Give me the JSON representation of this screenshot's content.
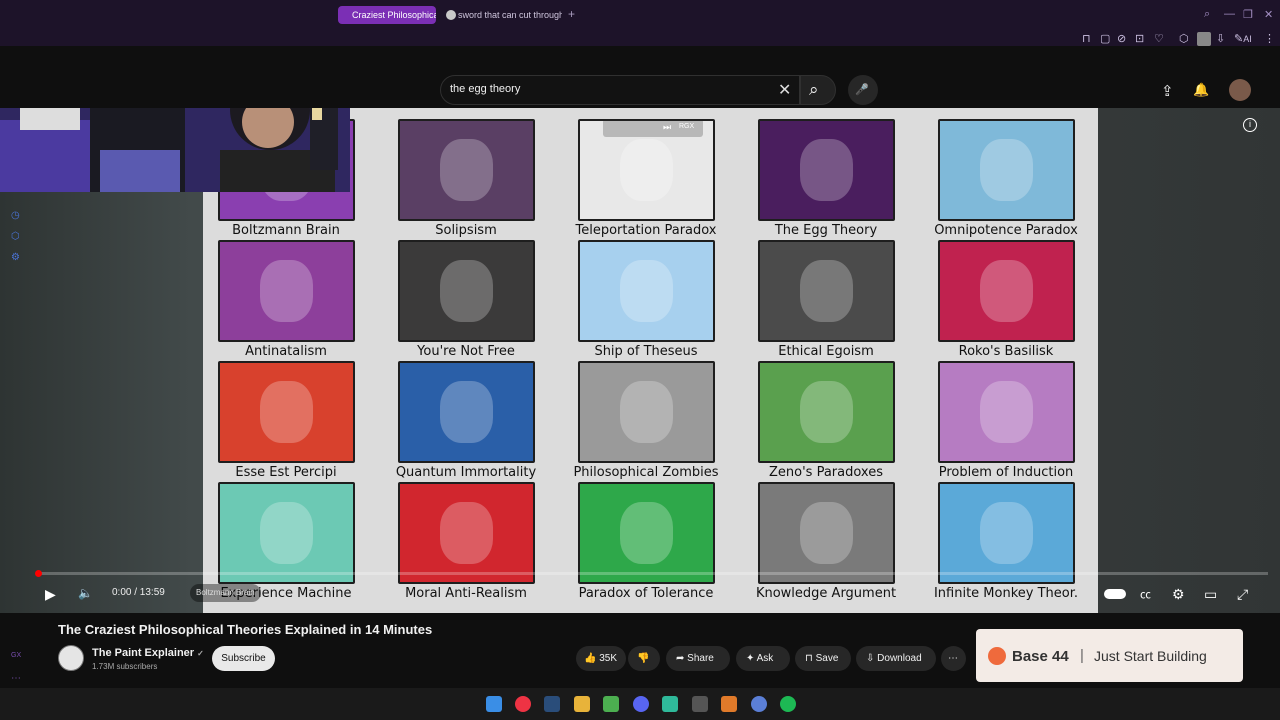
{
  "browser": {
    "tabs": [
      {
        "label": "Craziest Philosophica"
      },
      {
        "label": "sword that can cut through"
      }
    ],
    "new_tab": "+",
    "toolbar_text": "AI"
  },
  "masthead": {
    "search_value": "the egg theory",
    "clear_glyph": "✕",
    "search_glyph": "⌕",
    "mic_glyph": "🎤",
    "upload_glyph": "⇪",
    "bell_glyph": "🔔"
  },
  "overlay_controls": {
    "label": "RGX"
  },
  "slide": {
    "tiles": [
      {
        "label": "Boltzmann Brain",
        "color": "#8a3fb0"
      },
      {
        "label": "Solipsism",
        "color": "#5a3f64"
      },
      {
        "label": "Teleportation Paradox",
        "color": "#e8e8e8"
      },
      {
        "label": "The Egg Theory",
        "color": "#4a1e5e"
      },
      {
        "label": "Omnipotence Paradox",
        "color": "#7fb9d9"
      },
      {
        "label": "Antinatalism",
        "color": "#8d3f9b"
      },
      {
        "label": "You're Not Free",
        "color": "#3b3a3a"
      },
      {
        "label": "Ship of Theseus",
        "color": "#a7d0ee"
      },
      {
        "label": "Ethical Egoism",
        "color": "#4b4b4b"
      },
      {
        "label": "Roko's Basilisk",
        "color": "#c0224f"
      },
      {
        "label": "Esse Est Percipi",
        "color": "#d8412d"
      },
      {
        "label": "Quantum Immortality",
        "color": "#2a5fa8"
      },
      {
        "label": "Philosophical Zombies",
        "color": "#9a9a9a"
      },
      {
        "label": "Zeno's Paradoxes",
        "color": "#5aa04e"
      },
      {
        "label": "Problem of Induction",
        "color": "#b67cc2"
      },
      {
        "label": "Experience Machine",
        "color": "#6cc9b4"
      },
      {
        "label": "Moral Anti-Realism",
        "color": "#d1262e"
      },
      {
        "label": "Paradox of Tolerance",
        "color": "#2ea84a"
      },
      {
        "label": "Knowledge Argument",
        "color": "#7a7a7a"
      },
      {
        "label": "Infinite Monkey Theor.",
        "color": "#5ba9d8"
      }
    ]
  },
  "player": {
    "time": "0:00 / 13:59",
    "chapter": "Boltzmann Brain",
    "progress": 0.0,
    "play_glyph": "▶",
    "volume_glyph": "🔈"
  },
  "video": {
    "title": "The Craziest Philosophical Theories Explained in 14 Minutes",
    "channel_name": "The Paint Explainer",
    "verified_glyph": "✓",
    "subscribers": "1.73M subscribers",
    "subscribe_label": "Subscribe",
    "likes": "35K",
    "share_label": "Share",
    "ask_label": "Ask",
    "save_label": "Save",
    "download_label": "Download",
    "more_glyph": "⋯"
  },
  "ad": {
    "brand": "Base 44",
    "separator": "|",
    "tagline": "Just Start Building"
  }
}
